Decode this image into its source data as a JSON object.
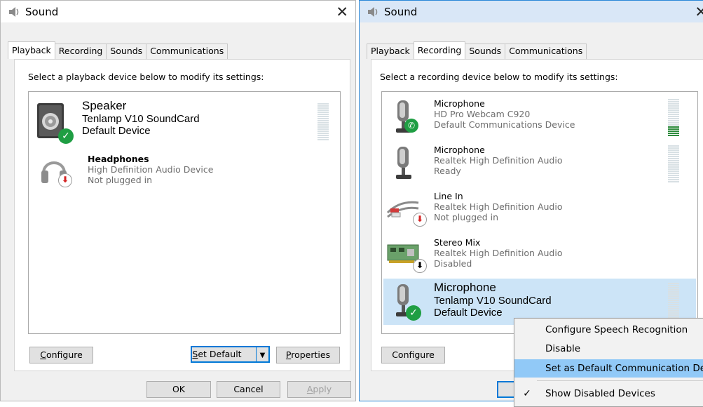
{
  "left_window": {
    "title": "Sound",
    "tabs": [
      "Playback",
      "Recording",
      "Sounds",
      "Communications"
    ],
    "active_tab": "Playback",
    "instruction": "Select a playback device below to modify its settings:",
    "devices": [
      {
        "name": "Speaker",
        "line2": "Tenlamp V10 SoundCard",
        "line3": "Default Device",
        "icon": "speaker-icon",
        "status": "default-check"
      },
      {
        "name": "Headphones",
        "line2": "High Definition Audio Device",
        "line3": "Not plugged in",
        "icon": "headphones-icon",
        "status": "unplugged-arrow"
      }
    ],
    "buttons": {
      "configure_prefix": "C",
      "configure_rest": "onfigure",
      "setdefault_prefix": "S",
      "setdefault_rest": "et Default",
      "properties_prefix": "P",
      "properties_rest": "roperties",
      "ok": "OK",
      "cancel": "Cancel",
      "apply_prefix": "A",
      "apply_rest": "pply"
    }
  },
  "right_window": {
    "title": "Sound",
    "tabs": [
      "Playback",
      "Recording",
      "Sounds",
      "Communications"
    ],
    "active_tab": "Recording",
    "instruction": "Select a recording device below to modify its settings:",
    "devices": [
      {
        "name": "Microphone",
        "line2": "HD Pro Webcam C920",
        "line3": "Default Communications Device",
        "icon": "microphone-icon",
        "status": "phone-badge",
        "meter_level": 0.25
      },
      {
        "name": "Microphone",
        "line2": "Realtek High Definition Audio",
        "line3": "Ready",
        "icon": "microphone-icon",
        "status": "none",
        "meter_level": 0
      },
      {
        "name": "Line In",
        "line2": "Realtek High Definition Audio",
        "line3": "Not plugged in",
        "icon": "line-in-cable-icon",
        "status": "unplugged-arrow"
      },
      {
        "name": "Stereo Mix",
        "line2": "Realtek High Definition Audio",
        "line3": "Disabled",
        "icon": "sound-card-icon",
        "status": "disabled-arrow"
      },
      {
        "name": "Microphone",
        "line2": "Tenlamp V10 SoundCard",
        "line3": "Default Device",
        "icon": "microphone-icon",
        "status": "default-check",
        "selected": true,
        "meter_level": 0
      }
    ],
    "buttons": {
      "configure": "Configure"
    }
  },
  "context_menu": {
    "items": [
      {
        "label": "Configure Speech Recognition"
      },
      {
        "label": "Disable"
      },
      {
        "label": "Set as Default Communication Device",
        "highlighted": true
      },
      {
        "label": "Show Disabled Devices",
        "checked": true
      }
    ]
  },
  "colors": {
    "accent": "#0078d7",
    "selection": "#cce4f7",
    "menu_highlight": "#91c9f7",
    "ok_green": "#1f9e43",
    "unplug_red": "#d42323"
  }
}
